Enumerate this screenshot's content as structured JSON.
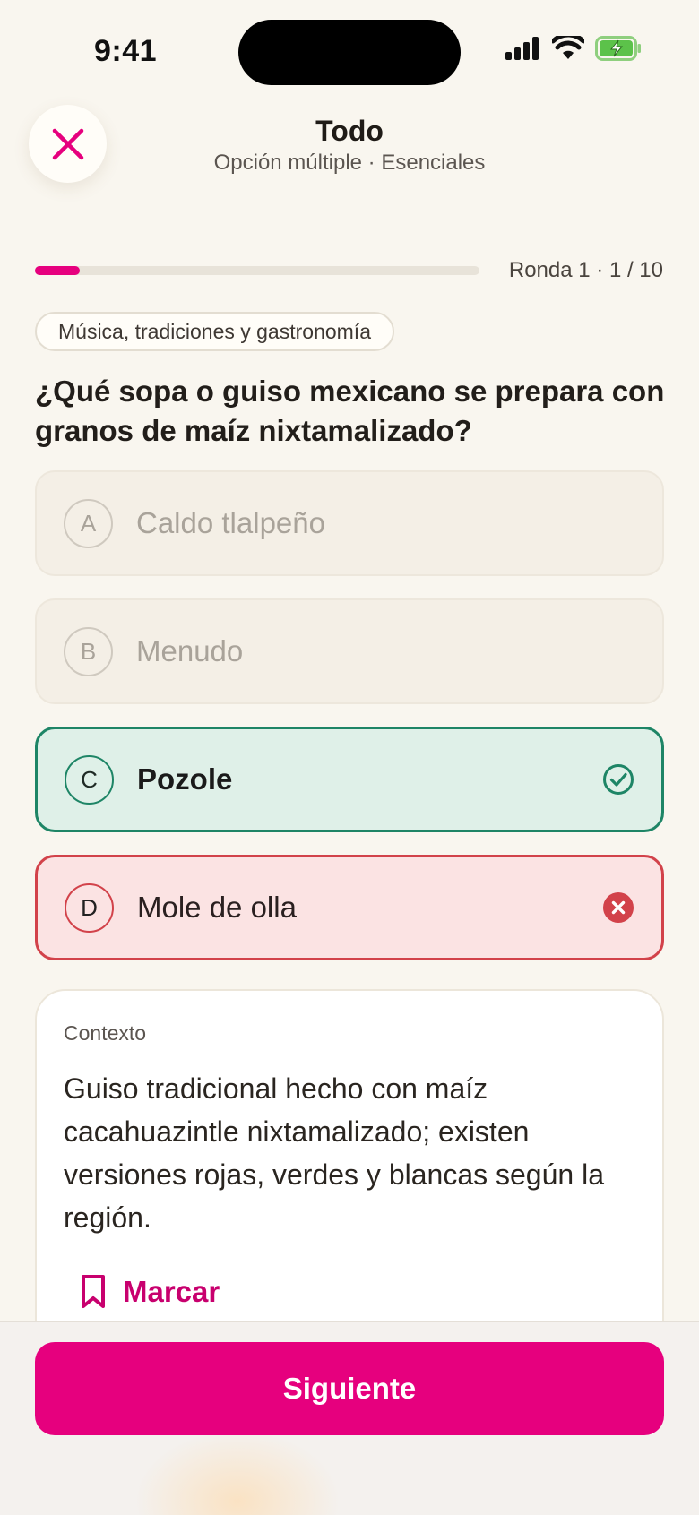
{
  "status_bar": {
    "time": "9:41"
  },
  "header": {
    "title": "Todo",
    "subtitle": "Opción múltiple · Esenciales"
  },
  "progress": {
    "fraction": 0.1,
    "label": "Ronda 1 · 1 / 10"
  },
  "category": "Música, tradiciones y gastronomía",
  "question": "¿Qué sopa o guiso mexicano se prepara con granos de maíz nixtamalizado?",
  "options": [
    {
      "letter": "A",
      "text": "Caldo tlalpeño",
      "state": "dim"
    },
    {
      "letter": "B",
      "text": "Menudo",
      "state": "dim"
    },
    {
      "letter": "C",
      "text": "Pozole",
      "state": "correct"
    },
    {
      "letter": "D",
      "text": "Mole de olla",
      "state": "wrong"
    }
  ],
  "context": {
    "label": "Contexto",
    "text": "Guiso tradicional hecho con maíz cacahuazintle nixtamalizado; existen versiones rojas, verdes y blancas según la región.",
    "bookmark_label": "Marcar"
  },
  "next_button": "Siguiente",
  "colors": {
    "accent": "#e6007e",
    "correct": "#1e8566",
    "wrong": "#d2424a"
  },
  "icons": {
    "close": "close-icon",
    "correct": "check-circle-icon",
    "wrong": "x-circle-icon",
    "bookmark": "bookmark-icon"
  }
}
